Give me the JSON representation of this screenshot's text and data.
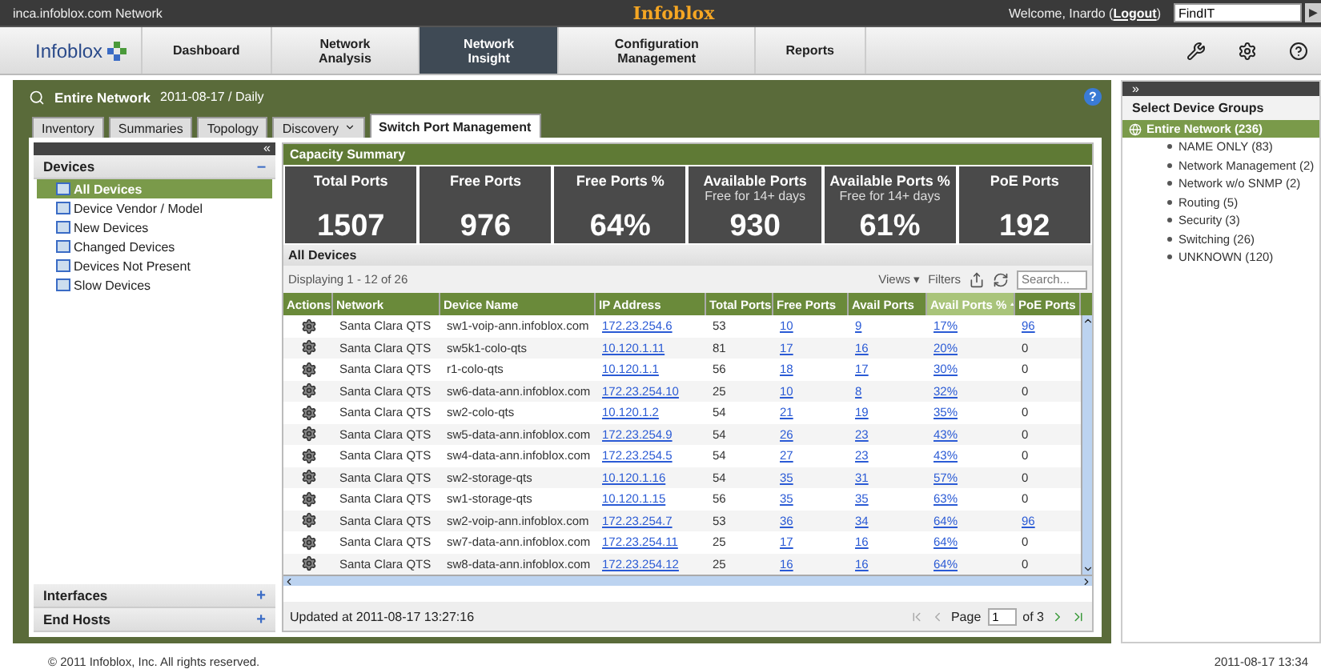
{
  "top_bar": {
    "network": "inca.infoblox.com Network",
    "brand": "Infoblox",
    "welcome": "Welcome, Inardo (",
    "logout": "Logout",
    "welcome_end": ")",
    "search_value": "FindIT",
    "search_go": "▶"
  },
  "nav": {
    "logo": "Infoblox",
    "tabs": [
      {
        "label": "Dashboard",
        "selected": false
      },
      {
        "label": "Network Analysis",
        "selected": false
      },
      {
        "label": "Network Insight",
        "selected": true
      },
      {
        "label": "Configuration Management",
        "selected": false
      },
      {
        "label": "Reports",
        "selected": false
      }
    ]
  },
  "context": {
    "title": "Entire Network",
    "subtitle": "2011-08-17 / Daily",
    "help": "?"
  },
  "tabs": [
    {
      "label": "Inventory",
      "selected": false,
      "dropdown": false
    },
    {
      "label": "Summaries",
      "selected": false,
      "dropdown": false
    },
    {
      "label": "Topology",
      "selected": false,
      "dropdown": false
    },
    {
      "label": "Discovery",
      "selected": false,
      "dropdown": true
    },
    {
      "label": "Switch Port Management",
      "selected": true,
      "dropdown": false
    }
  ],
  "sidebar": {
    "collapse": "«",
    "sections": [
      {
        "title": "Devices",
        "toggle": "–",
        "items": [
          {
            "label": "All Devices",
            "selected": true
          },
          {
            "label": "Device Vendor / Model",
            "selected": false
          },
          {
            "label": "New Devices",
            "selected": false
          },
          {
            "label": "Changed Devices",
            "selected": false
          },
          {
            "label": "Devices Not Present",
            "selected": false
          },
          {
            "label": "Slow Devices",
            "selected": false
          }
        ]
      },
      {
        "title": "Interfaces",
        "toggle": "+"
      },
      {
        "title": "End Hosts",
        "toggle": "+"
      }
    ]
  },
  "capacity": {
    "title": "Capacity Summary",
    "tiles": [
      {
        "label": "Total Ports",
        "value": "1507"
      },
      {
        "label": "Free Ports",
        "value": "976"
      },
      {
        "label": "Free Ports %",
        "value": "64%"
      },
      {
        "label": "Available Ports",
        "sub": "Free for 14+ days",
        "value": "930"
      },
      {
        "label": "Available Ports %",
        "sub": "Free for 14+ days",
        "value": "61%"
      },
      {
        "label": "PoE Ports",
        "value": "192"
      }
    ]
  },
  "devices": {
    "title": "All Devices",
    "displaying": "Displaying 1 - 12 of 26",
    "views": "Views ▾",
    "filters": "Filters",
    "search_placeholder": "Search...",
    "columns": [
      {
        "label": "Actions",
        "kind": "icon",
        "sorted": false
      },
      {
        "label": "Network",
        "kind": "text",
        "sorted": false
      },
      {
        "label": "Device Name",
        "kind": "text",
        "sorted": false
      },
      {
        "label": "IP Address",
        "kind": "link",
        "sorted": false
      },
      {
        "label": "Total Ports",
        "kind": "text",
        "sorted": false
      },
      {
        "label": "Free Ports",
        "kind": "link",
        "sorted": false
      },
      {
        "label": "Avail Ports",
        "kind": "link",
        "sorted": false
      },
      {
        "label": "Avail Ports %",
        "kind": "link",
        "sorted": true
      },
      {
        "label": "PoE Ports",
        "kind": "poe",
        "sorted": false
      }
    ],
    "rows": [
      {
        "cells": [
          "",
          "Santa Clara QTS",
          "sw1-voip-ann.infoblox.com",
          "172.23.254.6",
          "53",
          "10",
          "9",
          "17%",
          "96"
        ],
        "poe_link": true
      },
      {
        "cells": [
          "",
          "Santa Clara QTS",
          "sw5k1-colo-qts",
          "10.120.1.11",
          "81",
          "17",
          "16",
          "20%",
          "0"
        ],
        "poe_link": false
      },
      {
        "cells": [
          "",
          "Santa Clara QTS",
          "r1-colo-qts",
          "10.120.1.1",
          "56",
          "18",
          "17",
          "30%",
          "0"
        ],
        "poe_link": false
      },
      {
        "cells": [
          "",
          "Santa Clara QTS",
          "sw6-data-ann.infoblox.com",
          "172.23.254.10",
          "25",
          "10",
          "8",
          "32%",
          "0"
        ],
        "poe_link": false
      },
      {
        "cells": [
          "",
          "Santa Clara QTS",
          "sw2-colo-qts",
          "10.120.1.2",
          "54",
          "21",
          "19",
          "35%",
          "0"
        ],
        "poe_link": false
      },
      {
        "cells": [
          "",
          "Santa Clara QTS",
          "sw5-data-ann.infoblox.com",
          "172.23.254.9",
          "54",
          "26",
          "23",
          "43%",
          "0"
        ],
        "poe_link": false
      },
      {
        "cells": [
          "",
          "Santa Clara QTS",
          "sw4-data-ann.infoblox.com",
          "172.23.254.5",
          "54",
          "27",
          "23",
          "43%",
          "0"
        ],
        "poe_link": false
      },
      {
        "cells": [
          "",
          "Santa Clara QTS",
          "sw2-storage-qts",
          "10.120.1.16",
          "54",
          "35",
          "31",
          "57%",
          "0"
        ],
        "poe_link": false
      },
      {
        "cells": [
          "",
          "Santa Clara QTS",
          "sw1-storage-qts",
          "10.120.1.15",
          "56",
          "35",
          "35",
          "63%",
          "0"
        ],
        "poe_link": false
      },
      {
        "cells": [
          "",
          "Santa Clara QTS",
          "sw2-voip-ann.infoblox.com",
          "172.23.254.7",
          "53",
          "36",
          "34",
          "64%",
          "96"
        ],
        "poe_link": true
      },
      {
        "cells": [
          "",
          "Santa Clara QTS",
          "sw7-data-ann.infoblox.com",
          "172.23.254.11",
          "25",
          "17",
          "16",
          "64%",
          "0"
        ],
        "poe_link": false
      },
      {
        "cells": [
          "",
          "Santa Clara QTS",
          "sw8-data-ann.infoblox.com",
          "172.23.254.12",
          "25",
          "16",
          "16",
          "64%",
          "0"
        ],
        "poe_link": false
      }
    ],
    "updated": "Updated at 2011-08-17 13:27:16",
    "page_label": "Page",
    "page_value": "1",
    "page_of": "of 3"
  },
  "groups": {
    "expand": "»",
    "title": "Select Device Groups",
    "root": {
      "label": "Entire Network (236)",
      "selected": true,
      "children": [
        {
          "label": "NAME ONLY (83)",
          "selected": false
        },
        {
          "label": "Network Management (2)",
          "selected": false
        },
        {
          "label": "Network w/o SNMP (2)",
          "selected": false
        },
        {
          "label": "Routing (5)",
          "selected": false
        },
        {
          "label": "Security (3)",
          "selected": false
        },
        {
          "label": "Switching (26)",
          "selected": false
        },
        {
          "label": "UNKNOWN (120)",
          "selected": false
        }
      ]
    }
  },
  "footer": {
    "copyright": "© 2011 Infoblox, Inc. All rights reserved.",
    "time": "2011-08-17 13:34"
  }
}
